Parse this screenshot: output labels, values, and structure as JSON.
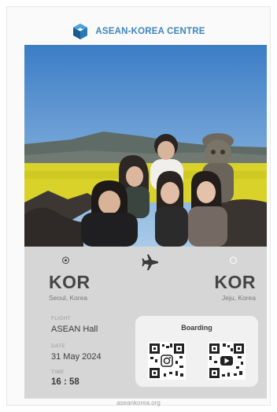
{
  "header": {
    "logo_text": "ASEAN-KOREA CENTRE",
    "logo_icon": "cube-logo-icon",
    "brand_color": "#3f86bd"
  },
  "photo": {
    "description_icon": "group-photo-image"
  },
  "ticket": {
    "origin": {
      "code": "KOR",
      "city": "Seoul, Korea"
    },
    "destination": {
      "code": "KOR",
      "city": "Jeju, Korea"
    },
    "plane_icon": "airplane-icon",
    "flight_label": "FLIGHT",
    "flight_value": "ASEAN Hall",
    "date_label": "DATE",
    "date_value": "31 May 2024",
    "time_label": "TIME",
    "time_value": "16 : 58",
    "boarding_title": "Boarding",
    "qr_icons": [
      "qr-code-instagram-icon",
      "qr-code-youtube-icon"
    ]
  },
  "footer": {
    "url": "aseankorea.org"
  }
}
